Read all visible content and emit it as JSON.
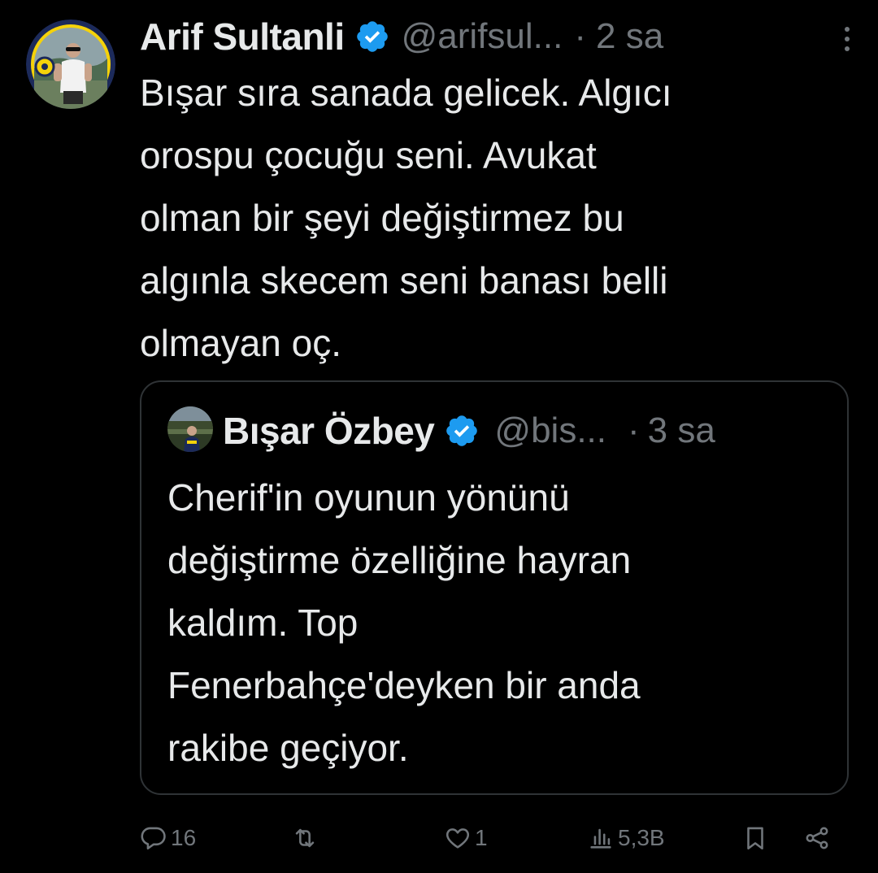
{
  "tweet": {
    "author": {
      "display_name": "Arif Sultanli",
      "handle": "@arifsul...",
      "verified_icon": "verified-badge-icon",
      "avatar_icon": "avatar"
    },
    "separator": "·",
    "time": "2 sa",
    "text": "Bışar sıra sanada gelicek. Algıcı\norospu çocuğu seni. Avukat\nolman bir şeyi değiştirmez bu\nalgınla skecem seni banası belli\nolmayan oç.",
    "more_icon": "more-options-icon"
  },
  "quoted_tweet": {
    "author": {
      "display_name": "Bışar Özbey",
      "handle": "@bis...",
      "verified_icon": "verified-badge-icon",
      "avatar_icon": "avatar"
    },
    "separator": "·",
    "time": "3 sa",
    "text": "Cherif'in oyunun yönünü\ndeğiştirme özelliğine hayran\nkaldım. Top\nFenerbahçe'deyken bir anda\nrakibe geçiyor."
  },
  "actions": {
    "reply": {
      "icon": "reply-icon",
      "count": "16"
    },
    "retweet": {
      "icon": "retweet-icon",
      "count": ""
    },
    "like": {
      "icon": "like-icon",
      "count": "1"
    },
    "views": {
      "icon": "views-icon",
      "count": "5,3B"
    },
    "bookmark": {
      "icon": "bookmark-icon"
    },
    "share": {
      "icon": "share-icon"
    }
  },
  "colors": {
    "background": "#000000",
    "text_primary": "#e7e9ea",
    "text_secondary": "#71767b",
    "border": "#2f3336",
    "verified_blue": "#1d9bf0",
    "fenerbahce_yellow": "#f5d20a",
    "fenerbahce_navy": "#1c2a5a"
  }
}
